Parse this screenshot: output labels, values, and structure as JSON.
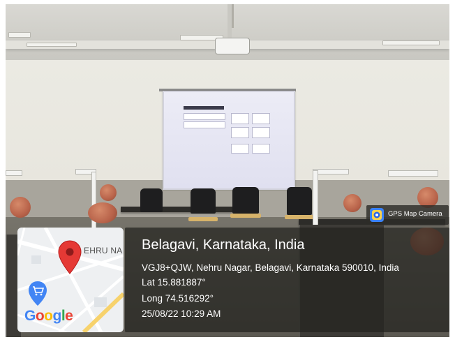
{
  "app_badge": {
    "label": "GPS Map Camera",
    "icon": "gps-map-camera-icon"
  },
  "location": {
    "title": "Belagavi, Karnataka, India",
    "address": "VGJ8+QJW, Nehru Nagar, Belagavi, Karnataka 590010, India",
    "lat": "Lat 15.881887°",
    "long": "Long 74.516292°",
    "datetime": "25/08/22 10:29 AM"
  },
  "map": {
    "street_label": "EHRU NA",
    "provider": "Google",
    "pin_icon": "map-pin-icon",
    "poi_icon": "shopping-cart-pin-icon",
    "colors": {
      "pin": "#e53935",
      "poi": "#4285f4",
      "google_blue": "#4285f4",
      "google_red": "#ea4335",
      "google_yellow": "#fbbc05",
      "google_green": "#34a853"
    }
  }
}
